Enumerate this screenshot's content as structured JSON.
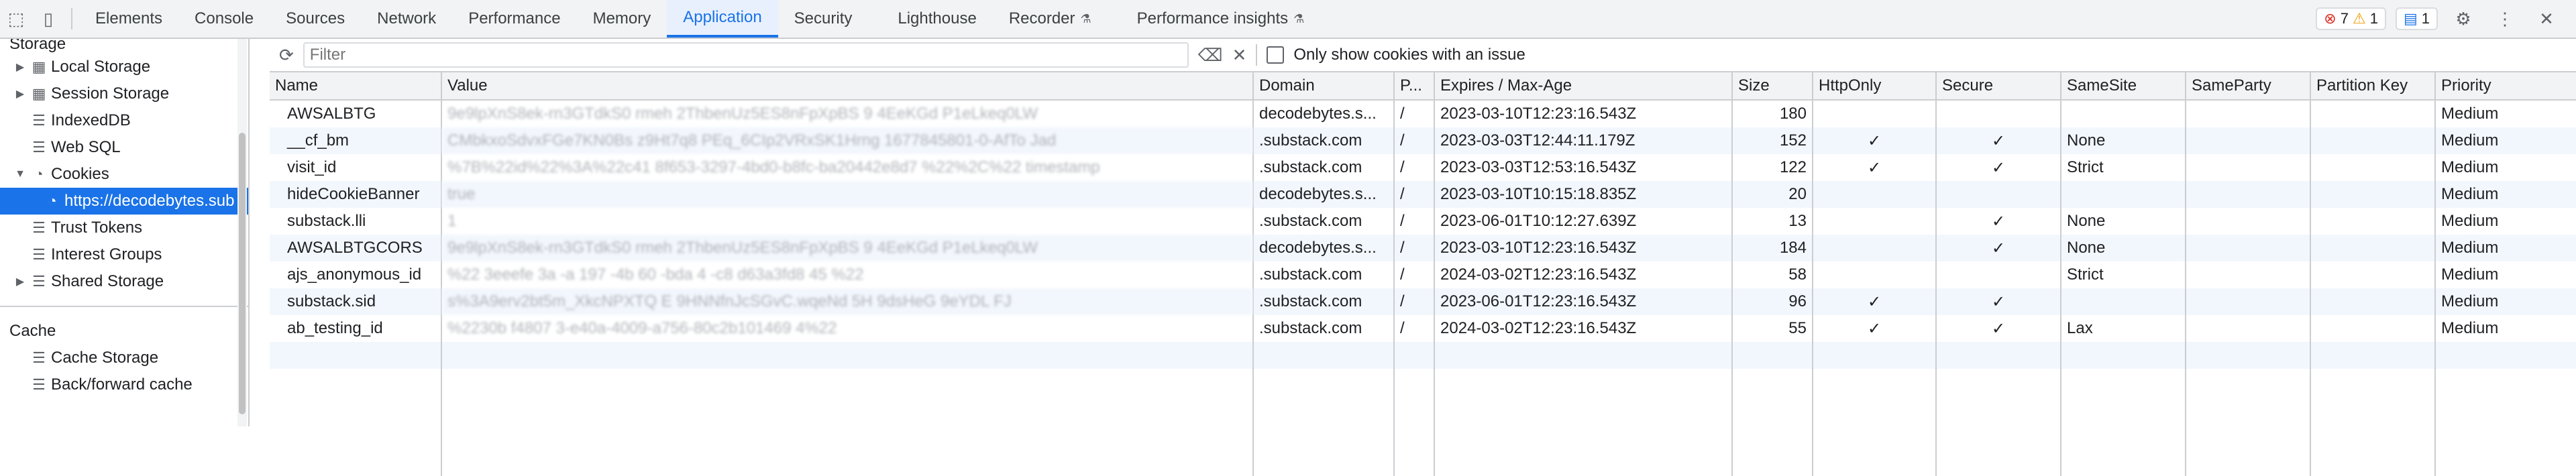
{
  "tabs": [
    "Elements",
    "Console",
    "Sources",
    "Network",
    "Performance",
    "Memory",
    "Application",
    "Security",
    "Lighthouse",
    "Recorder",
    "Performance insights"
  ],
  "status": {
    "errors": "7",
    "warnings": "1",
    "messages": "1"
  },
  "sidebar": {
    "storage_title": "Storage",
    "storage_items": [
      "Local Storage",
      "Session Storage",
      "IndexedDB",
      "Web SQL",
      "Cookies",
      "https://decodebytes.sub",
      "Trust Tokens",
      "Interest Groups",
      "Shared Storage"
    ],
    "cache_title": "Cache",
    "cache_items": [
      "Cache Storage",
      "Back/forward cache"
    ]
  },
  "filter": {
    "placeholder": "Filter",
    "only_issue_label": "Only show cookies with an issue"
  },
  "table": {
    "headers": [
      "Name",
      "Value",
      "Domain",
      "P...",
      "Expires / Max-Age",
      "Size",
      "HttpOnly",
      "Secure",
      "SameSite",
      "SameParty",
      "Partition Key",
      "Priority"
    ],
    "rows": [
      {
        "name": "AWSALBTG",
        "value": "9e9lpXnS8ek-rn3GTdkS0 rmeh 2ThbenUz5ES8nFpXpBS 9 4EeKGd P1eLkeq0LW",
        "domain": "decodebytes.s...",
        "path": "/",
        "expires": "2023-03-10T12:23:16.543Z",
        "size": "180",
        "httponly": "",
        "secure": "",
        "samesite": "",
        "sameparty": "",
        "partition": "",
        "priority": "Medium"
      },
      {
        "name": "__cf_bm",
        "value": "CMbkxoSdvxFGe7KN0Bs z9Ht7q8 PEq_6CIp2VRxSK1Hrng 1677845801-0-AfTo Jad",
        "domain": ".substack.com",
        "path": "/",
        "expires": "2023-03-03T12:44:11.179Z",
        "size": "152",
        "httponly": "✓",
        "secure": "✓",
        "samesite": "None",
        "sameparty": "",
        "partition": "",
        "priority": "Medium"
      },
      {
        "name": "visit_id",
        "value": "%7B%22id%22%3A%22c41 8f653-3297-4bd0-b8fc-ba20442e8d7 %22%2C%22 timestamp",
        "domain": ".substack.com",
        "path": "/",
        "expires": "2023-03-03T12:53:16.543Z",
        "size": "122",
        "httponly": "✓",
        "secure": "✓",
        "samesite": "Strict",
        "sameparty": "",
        "partition": "",
        "priority": "Medium"
      },
      {
        "name": "hideCookieBanner",
        "value": "true",
        "domain": "decodebytes.s...",
        "path": "/",
        "expires": "2023-03-10T10:15:18.835Z",
        "size": "20",
        "httponly": "",
        "secure": "",
        "samesite": "",
        "sameparty": "",
        "partition": "",
        "priority": "Medium"
      },
      {
        "name": "substack.lli",
        "value": "1",
        "domain": ".substack.com",
        "path": "/",
        "expires": "2023-06-01T10:12:27.639Z",
        "size": "13",
        "httponly": "",
        "secure": "✓",
        "samesite": "None",
        "sameparty": "",
        "partition": "",
        "priority": "Medium"
      },
      {
        "name": "AWSALBTGCORS",
        "value": "9e9lpXnS8ek-rn3GTdkS0 rmeh 2ThbenUz5ES8nFpXpBS 9 4EeKGd P1eLkeq0LW",
        "domain": "decodebytes.s...",
        "path": "/",
        "expires": "2023-03-10T12:23:16.543Z",
        "size": "184",
        "httponly": "",
        "secure": "✓",
        "samesite": "None",
        "sameparty": "",
        "partition": "",
        "priority": "Medium"
      },
      {
        "name": "ajs_anonymous_id",
        "value": "%22 3eeefe 3a -a 197 -4b 60 -bda 4 -c8 d63a3fd8 45 %22",
        "domain": ".substack.com",
        "path": "/",
        "expires": "2024-03-02T12:23:16.543Z",
        "size": "58",
        "httponly": "",
        "secure": "",
        "samesite": "Strict",
        "sameparty": "",
        "partition": "",
        "priority": "Medium"
      },
      {
        "name": "substack.sid",
        "value": "s%3A9erv2bt5m_XkcNPXTQ E 9HNNfnJcSGvC.wqeNd 5H 9dsHeG 9eYDL FJ",
        "domain": ".substack.com",
        "path": "/",
        "expires": "2023-06-01T12:23:16.543Z",
        "size": "96",
        "httponly": "✓",
        "secure": "✓",
        "samesite": "",
        "sameparty": "",
        "partition": "",
        "priority": "Medium"
      },
      {
        "name": "ab_testing_id",
        "value": "%2230b f4807 3-e40a-4009-a756-80c2b101469 4%22",
        "domain": ".substack.com",
        "path": "/",
        "expires": "2024-03-02T12:23:16.543Z",
        "size": "55",
        "httponly": "✓",
        "secure": "✓",
        "samesite": "Lax",
        "sameparty": "",
        "partition": "",
        "priority": "Medium"
      }
    ]
  }
}
